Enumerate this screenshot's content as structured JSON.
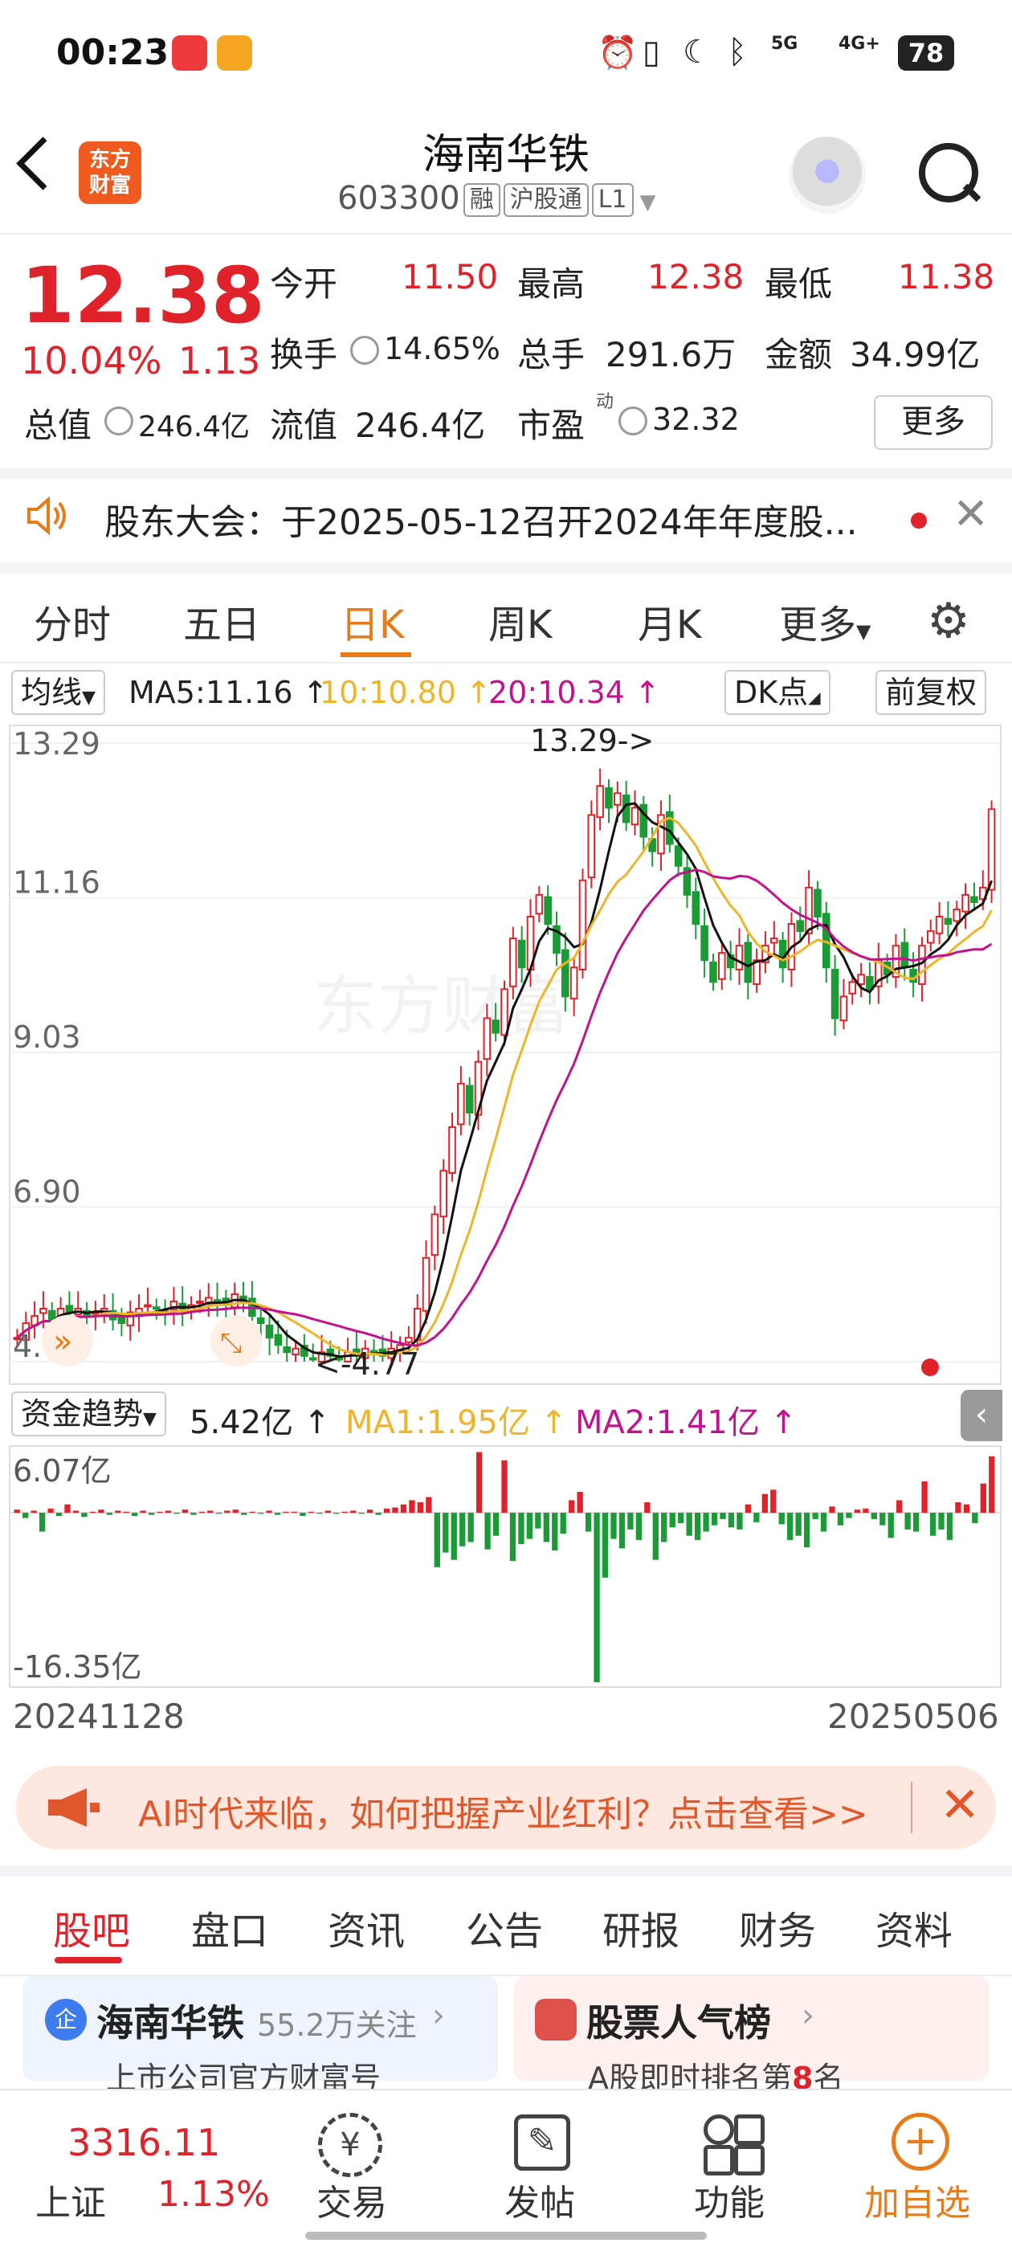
{
  "status_bar": {
    "time": "00:23",
    "battery": "78",
    "signal1": "5G",
    "signal2": "4G+"
  },
  "header": {
    "logo_text_1": "东方",
    "logo_text_2": "财富",
    "stock_name": "海南华铁",
    "stock_code": "603300",
    "tags": [
      "融",
      "沪股通",
      "L1"
    ]
  },
  "quote": {
    "price": "12.38",
    "change_pct": "10.04%",
    "change": "1.13",
    "open_label": "今开",
    "open": "11.50",
    "high_label": "最高",
    "high": "12.38",
    "low_label": "最低",
    "low": "11.38",
    "turnover_label": "换手",
    "turnover": "14.65%",
    "volume_label": "总手",
    "volume": "291.6万",
    "amount_label": "金额",
    "amount": "34.99亿",
    "mktcap_label": "总值",
    "mktcap": "246.4亿",
    "float_label": "流值",
    "float_cap": "246.4亿",
    "pe_label": "市盈",
    "pe_sup": "动",
    "pe": "32.32",
    "more_label": "更多"
  },
  "notice": {
    "text": "股东大会：于2025-05-12召开2024年年度股..."
  },
  "chart_tabs": {
    "items": [
      "分时",
      "五日",
      "日K",
      "周K",
      "月K",
      "更多"
    ],
    "active": "日K"
  },
  "chart_toolbar": {
    "ma_select": "均线",
    "ma5": "MA5:11.16 ↑",
    "ma10": "10:10.80 ↑",
    "ma20": "20:10.34 ↑",
    "dk_point": "DK点",
    "adjust": "前复权"
  },
  "chart_data": [
    {
      "type": "candlestick",
      "title": "",
      "ylim": [
        4.77,
        13.29
      ],
      "y_ticks": [
        "13.29",
        "11.16",
        "9.03",
        "6.90",
        "4.77"
      ],
      "annotations": [
        "13.29->",
        "<-4.77"
      ],
      "watermark": "东方财富",
      "colors": {
        "up": "#e0222b",
        "down": "#1a9b36",
        "ma5": "#111111",
        "ma10": "#f0b428",
        "ma20": "#c2128f"
      },
      "closes": [
        5.1,
        5.3,
        5.4,
        5.5,
        5.35,
        5.5,
        5.45,
        5.5,
        5.4,
        5.45,
        5.5,
        5.35,
        5.3,
        5.45,
        5.5,
        5.55,
        5.5,
        5.45,
        5.6,
        5.5,
        5.55,
        5.6,
        5.65,
        5.6,
        5.55,
        5.7,
        5.6,
        5.4,
        5.3,
        5.1,
        5.0,
        4.9,
        4.95,
        4.85,
        4.8,
        4.9,
        4.85,
        4.8,
        4.9,
        4.85,
        4.95,
        4.9,
        4.85,
        4.95,
        5.0,
        5.1,
        5.5,
        6.2,
        6.8,
        7.4,
        8.0,
        8.6,
        8.2,
        8.9,
        9.5,
        9.3,
        9.9,
        10.6,
        10.2,
        10.9,
        11.2,
        10.8,
        10.4,
        9.8,
        10.2,
        11.4,
        12.3,
        12.7,
        12.4,
        12.6,
        12.2,
        12.4,
        12.0,
        11.8,
        12.3,
        11.9,
        11.6,
        11.2,
        10.8,
        10.3,
        10.0,
        10.4,
        10.2,
        10.5,
        10.0,
        10.3,
        10.5,
        10.6,
        10.2,
        10.8,
        10.7,
        11.3,
        10.9,
        10.2,
        9.5,
        9.8,
        10.0,
        10.1,
        9.9,
        10.3,
        10.1,
        10.5,
        10.2,
        10.0,
        10.5,
        10.7,
        10.9,
        10.8,
        11.0,
        11.2,
        11.1,
        11.3,
        12.38
      ],
      "ma_current": {
        "ma5": 11.16,
        "ma10": 10.8,
        "ma20": 10.34
      }
    },
    {
      "type": "bar",
      "title": "",
      "indicator": "资金趋势",
      "ylim": [
        -16.35,
        6.07
      ],
      "y_ticks": [
        "6.07亿",
        "-16.35亿"
      ],
      "x_start": "20241128",
      "x_end": "20250506",
      "current_value": "5.42亿 ↑",
      "ma1": "MA1:1.95亿 ↑",
      "ma2": "MA2:1.41亿 ↑",
      "values": [
        0.3,
        -0.5,
        0.2,
        -1.8,
        0.4,
        -0.3,
        0.8,
        0.2,
        -0.4,
        0.1,
        0.3,
        -0.2,
        0.2,
        0.1,
        -0.3,
        0.2,
        -0.2,
        0.1,
        0.2,
        -0.1,
        0.3,
        -0.2,
        0.1,
        0.2,
        -0.1,
        0.2,
        0.3,
        -0.2,
        0.1,
        -0.1,
        0.2,
        -0.2,
        0.1,
        0.1,
        -0.3,
        0.1,
        -0.1,
        0.2,
        -0.1,
        0.1,
        0.2,
        -0.1,
        0.3,
        -0.2,
        0.4,
        0.5,
        0.8,
        1.2,
        1.0,
        1.5,
        -5.2,
        -3.8,
        -4.5,
        -3.2,
        -2.8,
        5.8,
        -3.5,
        -2.2,
        5.0,
        -4.6,
        -3.0,
        -2.5,
        -1.5,
        -2.8,
        -3.6,
        -2.0,
        1.2,
        2.0,
        -1.8,
        -16.2,
        -6.2,
        -2.5,
        -3.4,
        -1.6,
        -2.6,
        1.0,
        -4.5,
        -2.8,
        -1.4,
        -1.0,
        -2.2,
        -2.6,
        -1.8,
        -1.2,
        -0.6,
        -1.4,
        -1.6,
        0.8,
        -0.9,
        1.8,
        2.2,
        -1.1,
        -2.6,
        -2.2,
        -3.3,
        -0.6,
        -1.8,
        0.6,
        -1.2,
        -0.5,
        0.3,
        0.4,
        -0.6,
        -1.2,
        -2.4,
        1.2,
        -1.6,
        -1.8,
        3.0,
        -2.2,
        -1.6,
        -2.6,
        1.0,
        0.8,
        -1.0,
        2.8,
        5.4
      ]
    }
  ],
  "banner": {
    "text": "AI时代来临，如何把握产业红利？点击查看>>"
  },
  "bottom_tabs": {
    "items": [
      "股吧",
      "盘口",
      "资讯",
      "公告",
      "研报",
      "财务",
      "资料"
    ],
    "active": "股吧"
  },
  "cards": {
    "left_badge": "企",
    "left_title": "海南华铁",
    "left_follow": "55.2万关注",
    "left_sub": "上市公司官方财富号",
    "right_title": "股票人气榜",
    "right_sub_pre": "A股即时排名第",
    "right_rank": "8",
    "right_sub_post": "名"
  },
  "bottom_nav": {
    "index_value": "3316.11",
    "index_name": "上证",
    "index_pct": "1.13%",
    "trade": "交易",
    "post": "发帖",
    "func": "功能",
    "add_fav": "加自选"
  }
}
